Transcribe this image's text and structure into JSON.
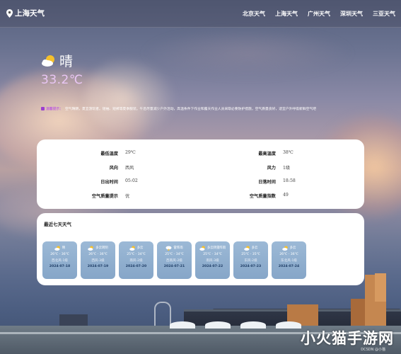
{
  "header": {
    "city_title": "上海天气",
    "nav": [
      "北京天气",
      "上海天气",
      "广州天气",
      "深圳天气",
      "三亚天气"
    ]
  },
  "current": {
    "icon": "sun-cloud-icon",
    "condition": "晴",
    "temperature": "33.2℃"
  },
  "notice": {
    "label": "温馨提示：",
    "text": "空气晴朗，夏宜游玩者。短袖、短裤等夏季服装。午后尽量减少户外活动，高温条件下作业和露天作业人员采取必要防护措施，空气质量良好，适宜户外呼吸新鲜空气吧"
  },
  "stats": {
    "low_label": "最低温度",
    "low_value": "29℃",
    "high_label": "最高温度",
    "high_value": "38℃",
    "wind_dir_label": "风向",
    "wind_dir_value": "西风",
    "wind_level_label": "风力",
    "wind_level_value": "1级",
    "sunrise_label": "日出时间",
    "sunrise_value": "05:02",
    "sunset_label": "日落时间",
    "sunset_value": "18:58",
    "aqi_tip_label": "空气质量提示",
    "aqi_tip_value": "优",
    "aqi_label": "空气质量指数",
    "aqi_value": "49"
  },
  "forecast": {
    "title": "最近七天天气",
    "days": [
      {
        "cond": "晴",
        "temp": "26℃ - 36℃",
        "wind": "西北风-1级",
        "date": "2024-07-18",
        "icon": "sun-cloud-icon"
      },
      {
        "cond": "多云转阴",
        "temp": "26℃ - 36℃",
        "wind": "西风-3级",
        "date": "2024-07-19",
        "icon": "sun-cloud-icon"
      },
      {
        "cond": "多云",
        "temp": "25℃ - 34℃",
        "wind": "南风-2级",
        "date": "2024-07-20",
        "icon": "sun-cloud-icon"
      },
      {
        "cond": "雷阵雨",
        "temp": "25℃ - 34℃",
        "wind": "西南风-2级",
        "date": "2024-07-21",
        "icon": "storm-cloud-icon"
      },
      {
        "cond": "多云转雷阵雨",
        "temp": "25℃ - 34℃",
        "wind": "南风-3级",
        "date": "2024-07-22",
        "icon": "sun-cloud-icon"
      },
      {
        "cond": "多云",
        "temp": "25℃ - 35℃",
        "wind": "东风-2级",
        "date": "2024-07-23",
        "icon": "sun-cloud-icon"
      },
      {
        "cond": "多云",
        "temp": "26℃ - 36℃",
        "wind": "东北风-1级",
        "date": "2024-07-24",
        "icon": "sun-cloud-icon"
      }
    ]
  },
  "watermark": {
    "text": "小火猫手游网",
    "sub": "DCSDN @小猫"
  }
}
